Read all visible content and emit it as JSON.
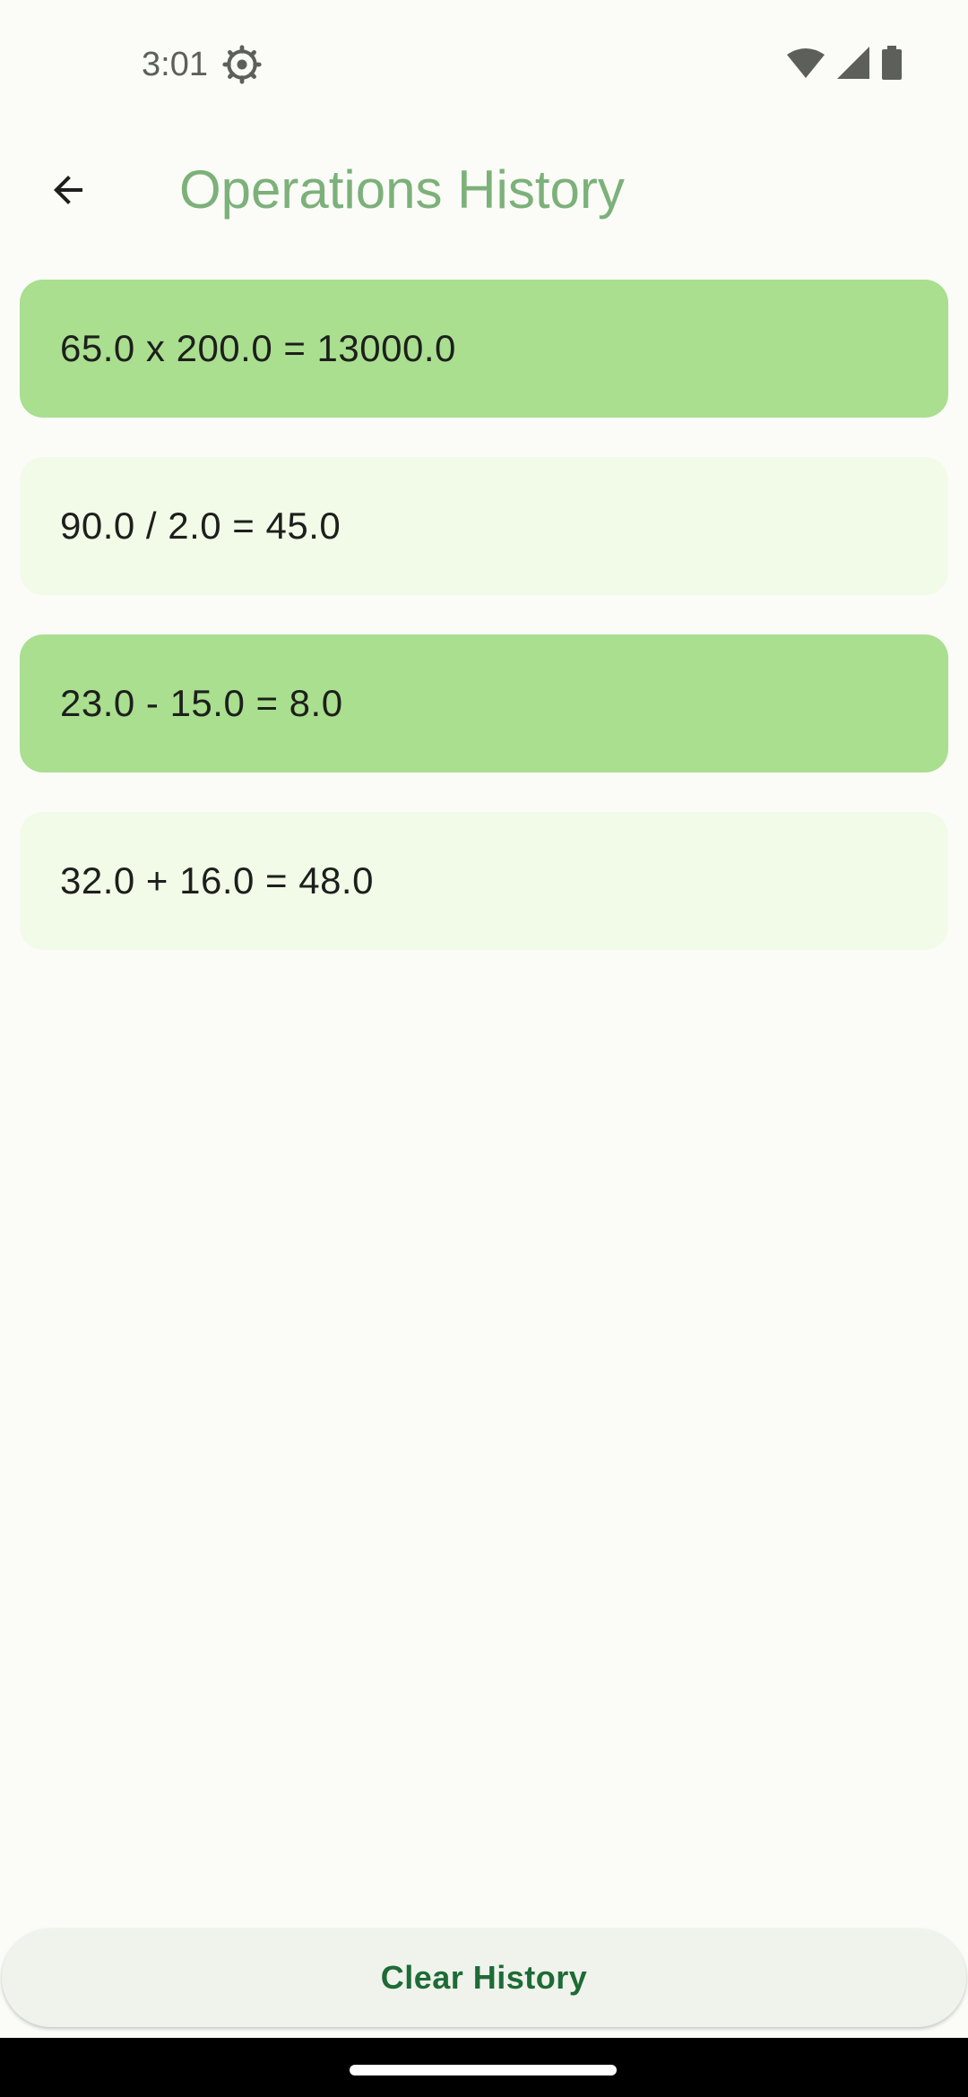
{
  "status_bar": {
    "time": "3:01",
    "icons": [
      "settings-gear-icon",
      "wifi-icon",
      "cellular-signal-icon",
      "battery-icon"
    ]
  },
  "app_bar": {
    "back_icon": "arrow-back-icon",
    "title": "Operations History",
    "title_color": "#7cb17a"
  },
  "history": {
    "items": [
      {
        "text": "65.0 x 200.0 = 13000.0",
        "style": "dark"
      },
      {
        "text": "90.0 / 2.0 = 45.0",
        "style": "light"
      },
      {
        "text": "23.0 - 15.0 = 8.0",
        "style": "dark"
      },
      {
        "text": "32.0 + 16.0 = 48.0",
        "style": "light"
      }
    ]
  },
  "actions": {
    "clear_label": "Clear History"
  },
  "colors": {
    "background": "#fbfcf7",
    "card_dark": "#a9df8f",
    "card_light": "#f2fbe8",
    "button_text": "#1e6b35"
  }
}
